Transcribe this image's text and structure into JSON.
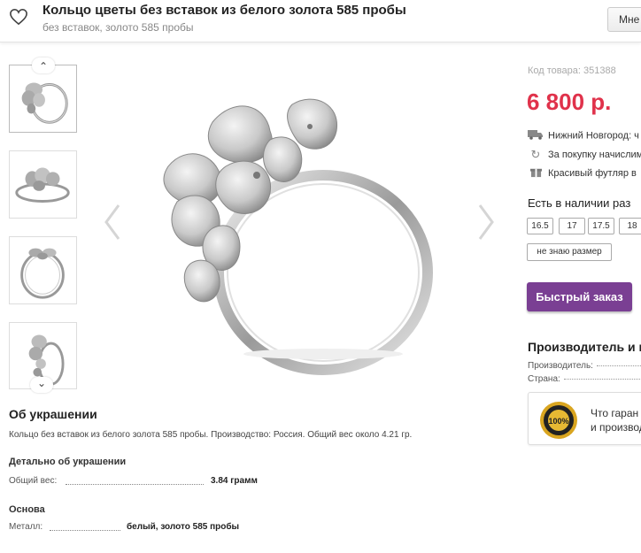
{
  "header": {
    "title": "Кольцо цветы без вставок из белого золота 585 пробы",
    "subtitle": "без вставок, золото 585 пробы",
    "button_label": "Мне"
  },
  "thumbnails": {
    "up_arrow": "⌃",
    "down_arrow": "⌄",
    "count": 4
  },
  "product": {
    "sku": "Код товара: 351388",
    "price": "6 800 р.",
    "delivery": "Нижний Новгород: ч",
    "bonus": "За покупку начислим",
    "gift": "Красивый футляр в",
    "availability": "Есть в наличии раз",
    "sizes": [
      "16.5",
      "17",
      "17.5",
      "18"
    ],
    "no_size": "не знаю размер",
    "quick_order": "Быстрый заказ"
  },
  "manufacturer": {
    "heading": "Производитель и п",
    "maker_label": "Производитель:",
    "country_label": "Страна:",
    "guarantee_line1": "Что гаран",
    "guarantee_line2": "и производ",
    "seal_text": "100%"
  },
  "about": {
    "heading": "Об украшении",
    "text": "Кольцо без вставок из белого золота 585 пробы. Производство: Россия. Общий вес около 4.21 гр.",
    "details_heading": "Детально об украшении",
    "weight_label": "Общий вес:",
    "weight_value": "3.84 грамм",
    "base_heading": "Основа",
    "metal_label": "Металл:",
    "metal_value": "белый, золото 585 пробы"
  },
  "colors": {
    "price": "#e0324b",
    "quick_order": "#7a3f93"
  }
}
